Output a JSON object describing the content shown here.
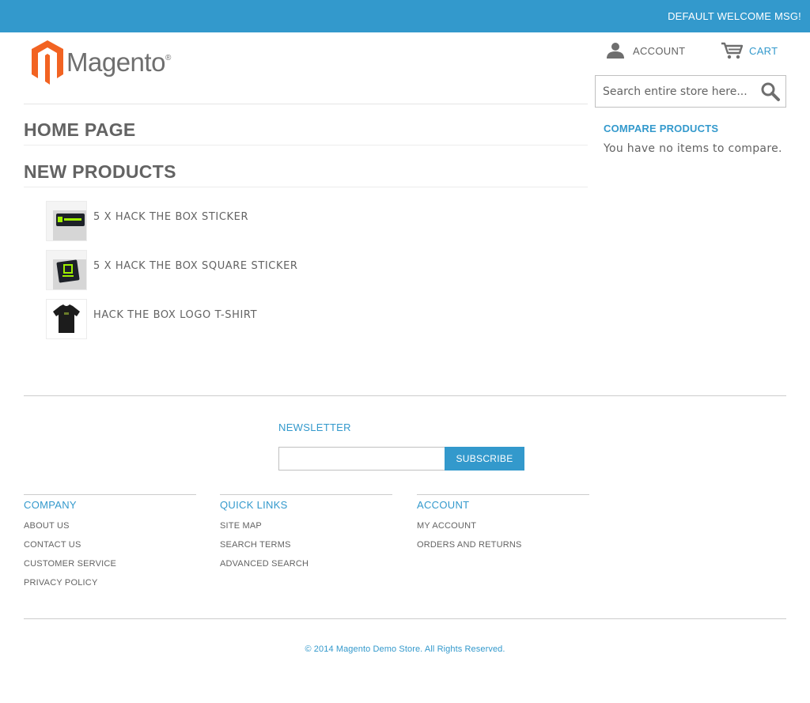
{
  "header": {
    "welcome": "DEFAULT WELCOME MSG!",
    "logo_text": "Magento",
    "account_label": "ACCOUNT",
    "cart_label": "CART",
    "search_placeholder": "Search entire store here..."
  },
  "main": {
    "page_title": "HOME PAGE",
    "section_title": "NEW PRODUCTS",
    "products": [
      {
        "name": "5 X HACK THE BOX STICKER"
      },
      {
        "name": "5 X HACK THE BOX SQUARE STICKER"
      },
      {
        "name": "HACK THE BOX LOGO T-SHIRT"
      }
    ]
  },
  "sidebar": {
    "compare_title": "COMPARE PRODUCTS",
    "compare_empty": "You have no items to compare."
  },
  "footer": {
    "newsletter_title": "NEWSLETTER",
    "subscribe_label": "SUBSCRIBE",
    "columns": [
      {
        "title": "COMPANY",
        "links": [
          "ABOUT US",
          "CONTACT US",
          "CUSTOMER SERVICE",
          "PRIVACY POLICY"
        ]
      },
      {
        "title": "QUICK LINKS",
        "links": [
          "SITE MAP",
          "SEARCH TERMS",
          "ADVANCED SEARCH"
        ]
      },
      {
        "title": "ACCOUNT",
        "links": [
          "MY ACCOUNT",
          "ORDERS AND RETURNS"
        ]
      }
    ],
    "copyright": "© 2014 Magento Demo Store. All Rights Reserved."
  },
  "colors": {
    "accent": "#3399cc",
    "text": "#636363",
    "logo_orange": "#f26322"
  }
}
